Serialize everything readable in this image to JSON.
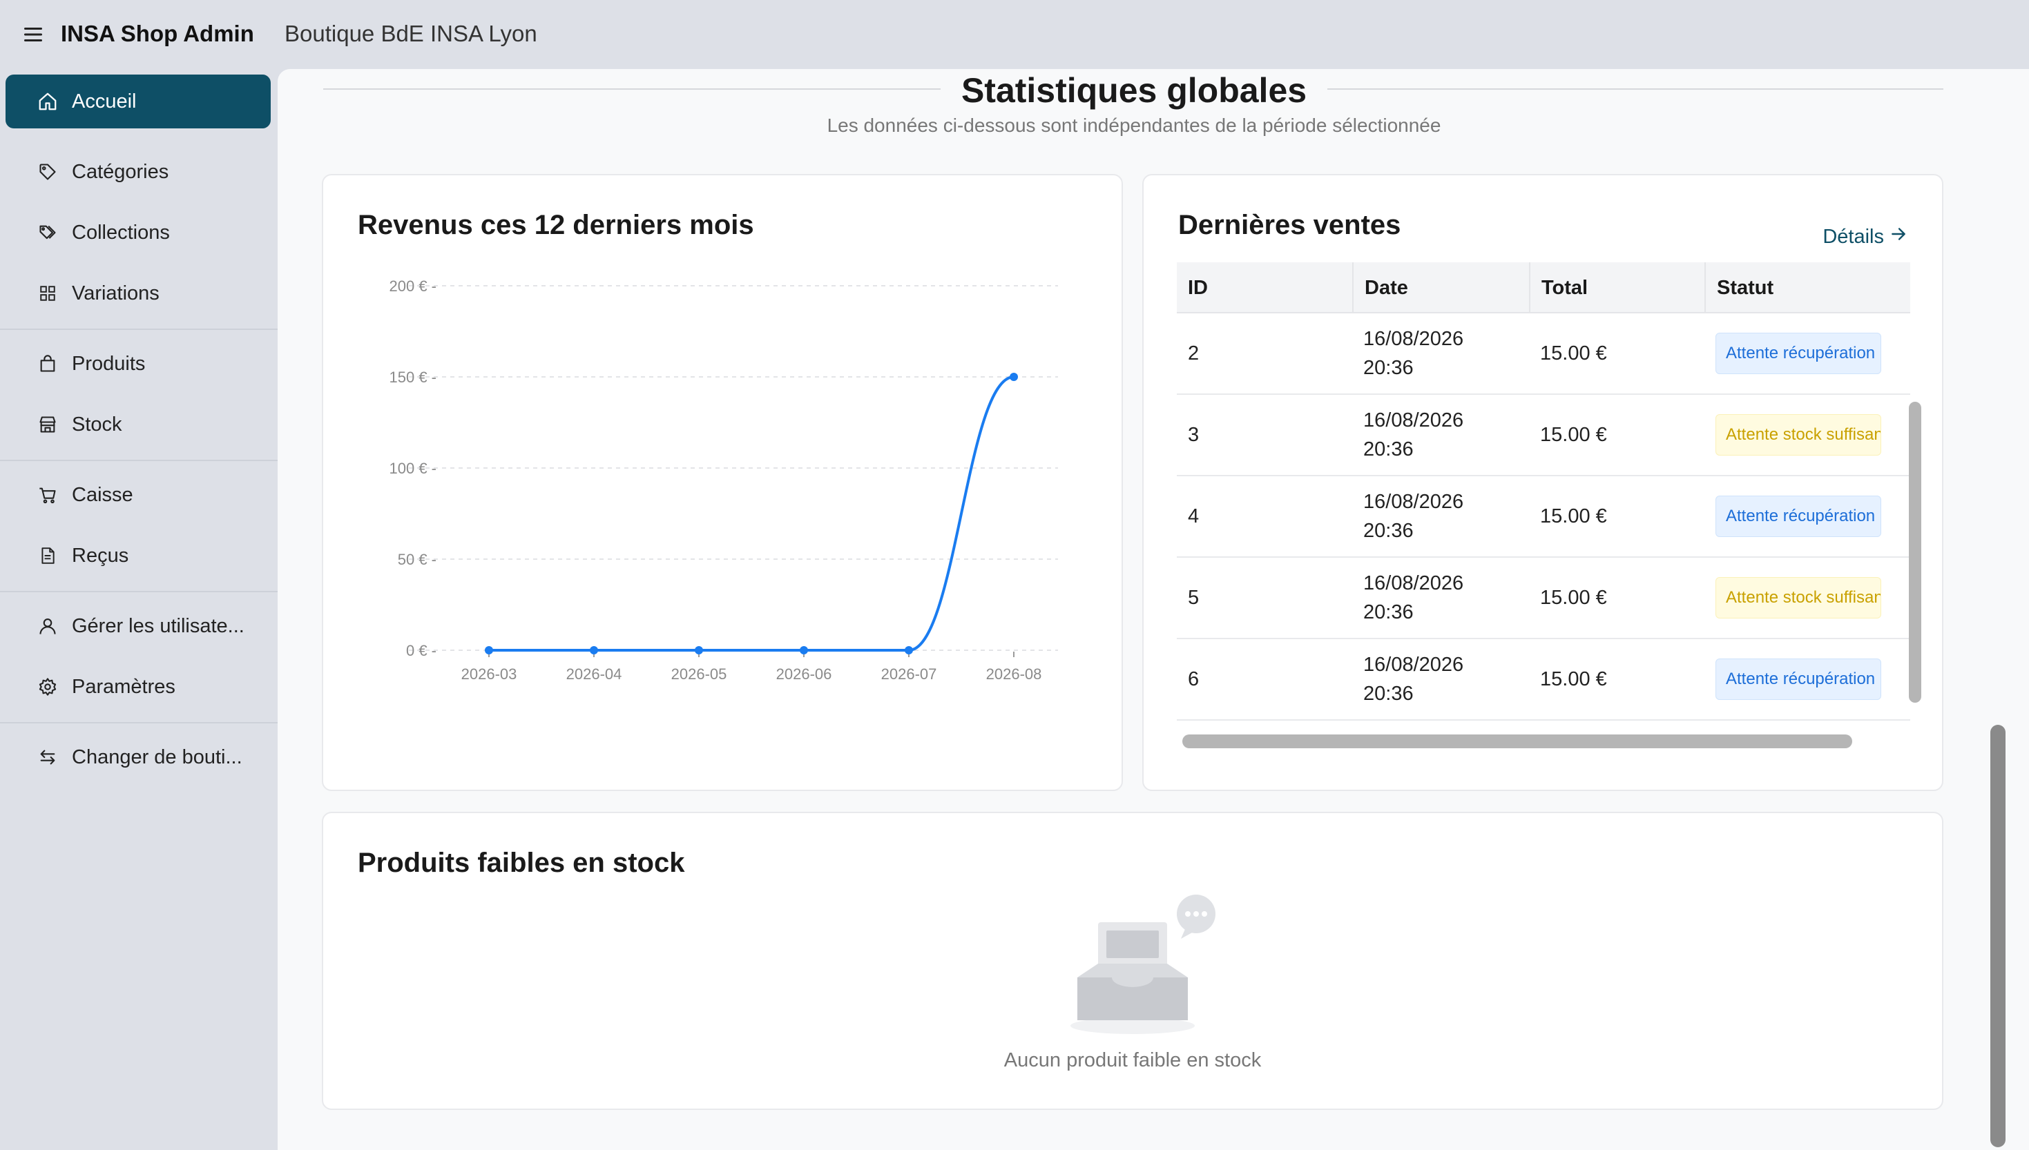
{
  "header": {
    "app_title": "INSA Shop Admin",
    "shop_name": "Boutique BdE INSA Lyon"
  },
  "sidebar": {
    "items": [
      {
        "label": "Accueil",
        "icon": "home-icon",
        "active": true
      },
      {
        "label": "Catégories",
        "icon": "tag-icon"
      },
      {
        "label": "Collections",
        "icon": "tags-icon"
      },
      {
        "label": "Variations",
        "icon": "grid-icon"
      },
      {
        "label": "Produits",
        "icon": "shopping-bag-icon"
      },
      {
        "label": "Stock",
        "icon": "store-icon"
      },
      {
        "label": "Caisse",
        "icon": "cart-icon"
      },
      {
        "label": "Reçus",
        "icon": "receipt-icon"
      },
      {
        "label": "Gérer les utilisate...",
        "icon": "user-icon"
      },
      {
        "label": "Paramètres",
        "icon": "gear-icon"
      },
      {
        "label": "Changer de bouti...",
        "icon": "switch-icon"
      }
    ]
  },
  "main": {
    "section_title": "Statistiques globales",
    "section_subtitle": "Les données ci-dessous sont indépendantes de la période sélectionnée"
  },
  "revenue_card": {
    "title": "Revenus ces 12 derniers mois"
  },
  "chart_data": {
    "type": "line",
    "title": "Revenus ces 12 derniers mois",
    "x": [
      "2026-03",
      "2026-04",
      "2026-05",
      "2026-06",
      "2026-07",
      "2026-08"
    ],
    "series": [
      {
        "values": [
          0,
          0,
          0,
          0,
          0,
          150
        ]
      }
    ],
    "yticks": [
      "200 € -",
      "150 € -",
      "100 € -",
      "50 € -",
      "0 € -"
    ],
    "ytick_values": [
      200,
      150,
      100,
      50,
      0
    ],
    "ylim": [
      0,
      200
    ],
    "grid": true,
    "color": "#1a7cf0"
  },
  "sales_card": {
    "title": "Dernières ventes",
    "details_label": "Détails",
    "columns": [
      "ID",
      "Date",
      "Total",
      "Statut"
    ],
    "rows": [
      {
        "id": "2",
        "date": "16/08/2026",
        "time": "20:36",
        "total": "15.00 €",
        "status": "Attente récupération",
        "status_color": "blue"
      },
      {
        "id": "3",
        "date": "16/08/2026",
        "time": "20:36",
        "total": "15.00 €",
        "status": "Attente stock suffisant",
        "status_color": "yellow"
      },
      {
        "id": "4",
        "date": "16/08/2026",
        "time": "20:36",
        "total": "15.00 €",
        "status": "Attente récupération",
        "status_color": "blue"
      },
      {
        "id": "5",
        "date": "16/08/2026",
        "time": "20:36",
        "total": "15.00 €",
        "status": "Attente stock suffisant",
        "status_color": "yellow"
      },
      {
        "id": "6",
        "date": "16/08/2026",
        "time": "20:36",
        "total": "15.00 €",
        "status": "Attente récupération",
        "status_color": "blue"
      }
    ]
  },
  "low_stock_card": {
    "title": "Produits faibles en stock",
    "empty_text": "Aucun produit faible en stock"
  },
  "colors": {
    "accent": "#0e4f66",
    "chart_line": "#1a7cf0",
    "badge_blue_text": "#1d6ed8",
    "badge_yellow_text": "#c9a100"
  }
}
